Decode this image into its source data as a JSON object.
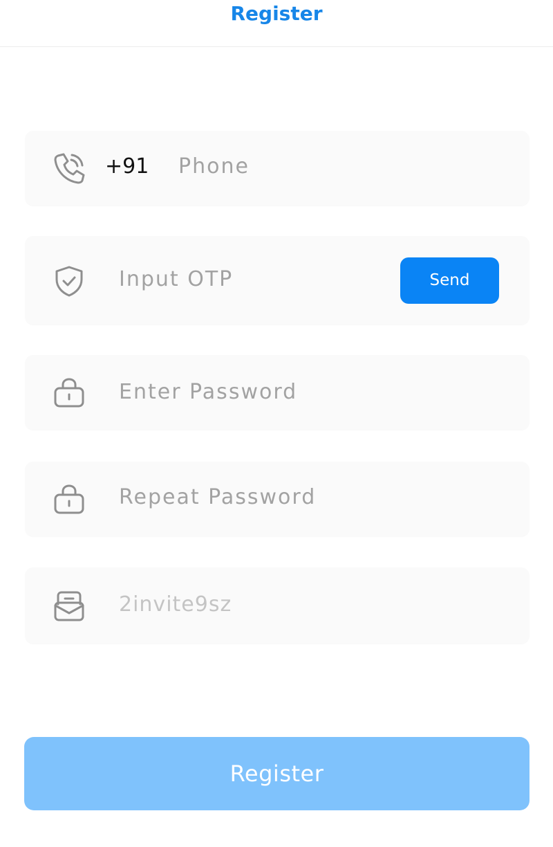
{
  "header": {
    "title": "Register"
  },
  "form": {
    "phone": {
      "icon": "phone-icon",
      "prefix": "+91",
      "placeholder": "Phone"
    },
    "otp": {
      "icon": "shield-check-icon",
      "placeholder": "Input OTP",
      "send_label": "Send"
    },
    "password": {
      "icon": "lock-icon",
      "placeholder": "Enter Password"
    },
    "repeat_password": {
      "icon": "lock-icon",
      "placeholder": "Repeat Password"
    },
    "invite": {
      "icon": "envelope-icon",
      "value": "2invite9sz"
    }
  },
  "register_label": "Register",
  "colors": {
    "accent": "#1786e8",
    "send_button": "#0a84f5",
    "register_button": "#7fc2fc",
    "field_background": "#fafafa",
    "placeholder": "#a2a2a2"
  }
}
